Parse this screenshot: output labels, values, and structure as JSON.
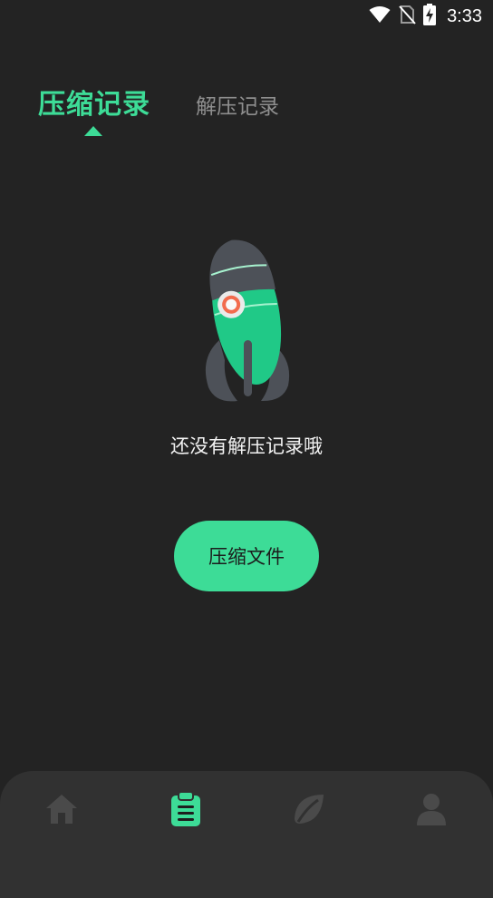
{
  "status_bar": {
    "time": "3:33",
    "icons": [
      "wifi-icon",
      "no-sim-icon",
      "battery-charging-icon"
    ]
  },
  "tabs": [
    {
      "label": "压缩记录",
      "active": true
    },
    {
      "label": "解压记录",
      "active": false
    }
  ],
  "empty_state": {
    "illustration": "rocket-icon",
    "message": "还没有解压记录哦"
  },
  "primary_action": {
    "label": "压缩文件"
  },
  "bottom_nav": {
    "items": [
      {
        "icon": "home-icon",
        "active": false
      },
      {
        "icon": "clipboard-icon",
        "active": true
      },
      {
        "icon": "leaf-icon",
        "active": false
      },
      {
        "icon": "person-icon",
        "active": false
      }
    ]
  },
  "colors": {
    "accent": "#3ddc97",
    "background": "#232323",
    "nav_background": "#313131",
    "inactive_tab": "#8e8e8e",
    "nav_icon_inactive": "#4a4a4a"
  }
}
